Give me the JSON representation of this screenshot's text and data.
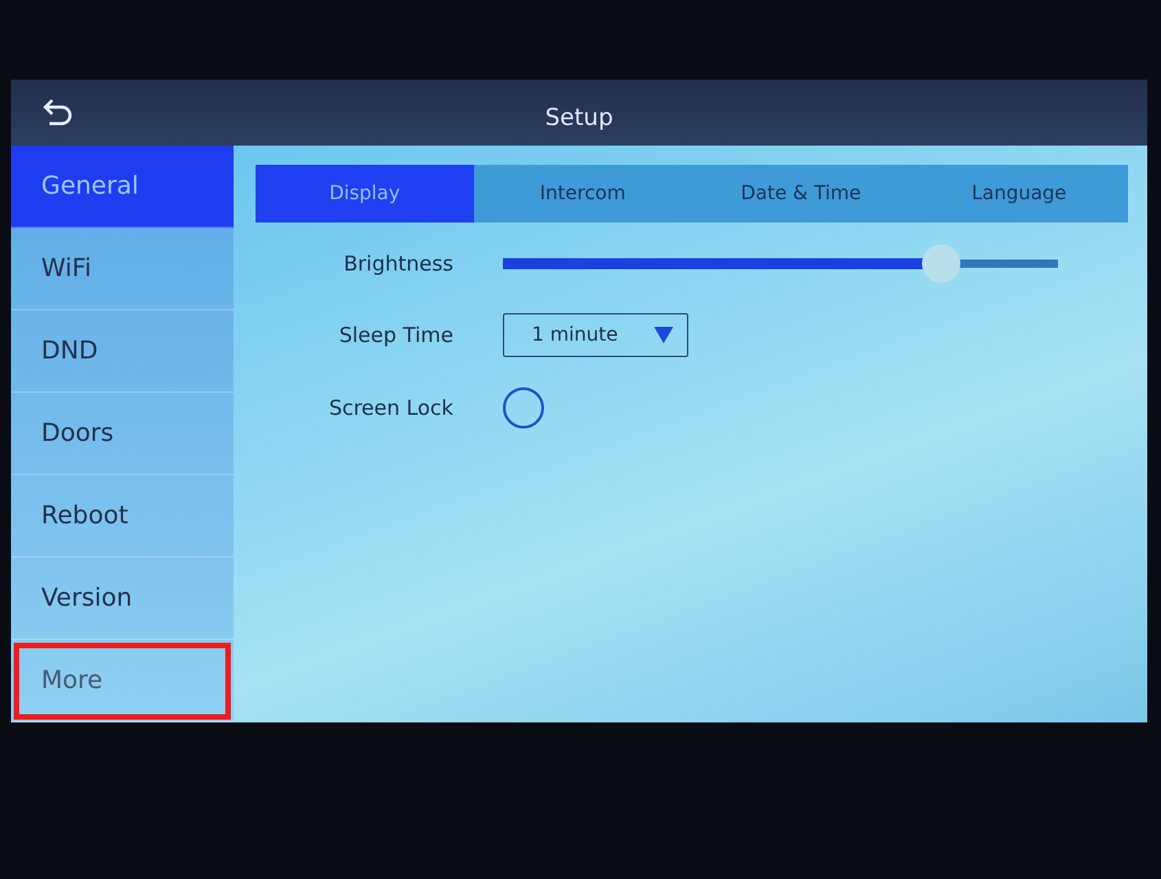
{
  "header": {
    "title": "Setup"
  },
  "sidebar": {
    "items": [
      {
        "label": "General",
        "selected": true,
        "highlighted": false
      },
      {
        "label": "WiFi",
        "selected": false,
        "highlighted": false
      },
      {
        "label": "DND",
        "selected": false,
        "highlighted": false
      },
      {
        "label": "Doors",
        "selected": false,
        "highlighted": false
      },
      {
        "label": "Reboot",
        "selected": false,
        "highlighted": false
      },
      {
        "label": "Version",
        "selected": false,
        "highlighted": false
      },
      {
        "label": "More",
        "selected": false,
        "highlighted": true
      }
    ]
  },
  "tabs": [
    {
      "label": "Display",
      "selected": true
    },
    {
      "label": "Intercom",
      "selected": false
    },
    {
      "label": "Date & Time",
      "selected": false
    },
    {
      "label": "Language",
      "selected": false
    }
  ],
  "settings": [
    {
      "kind": "slider",
      "label": "Brightness",
      "level": 0.79
    },
    {
      "kind": "dropdown",
      "label": "Sleep Time",
      "value": "1 minute"
    },
    {
      "kind": "toggle",
      "label": "Screen Lock",
      "checked": false
    }
  ]
}
